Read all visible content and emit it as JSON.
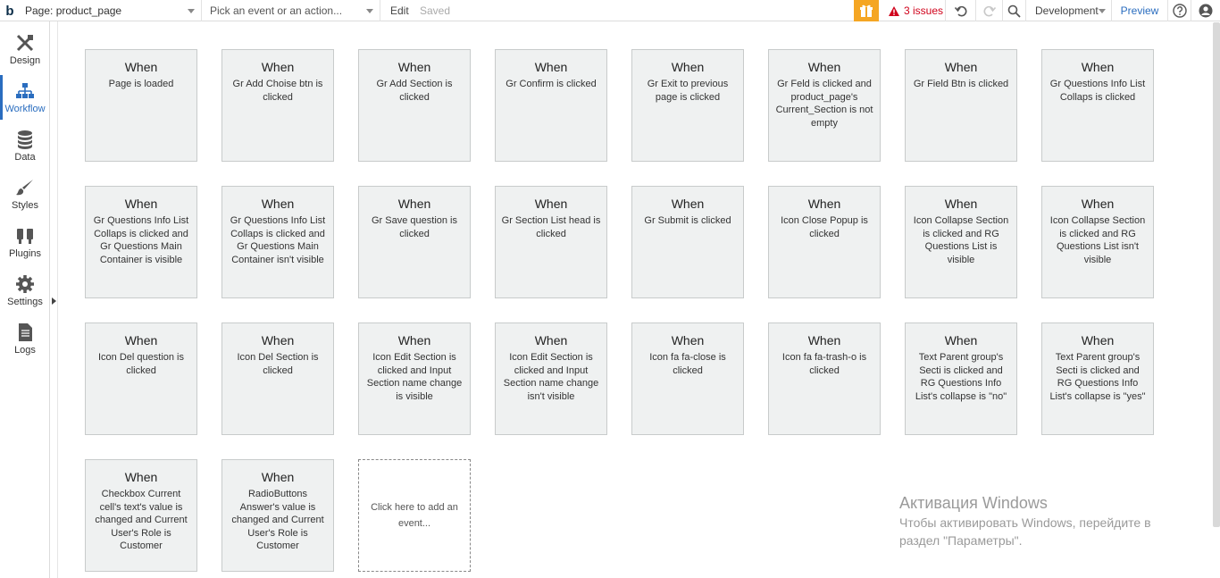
{
  "topbar": {
    "logo": "b",
    "page_select": "Page: product_page",
    "event_placeholder": "Pick an event or an action...",
    "edit_label": "Edit",
    "saved_label": "Saved",
    "issues_label": "3 issues",
    "environment": "Development",
    "preview_label": "Preview"
  },
  "sidebar": {
    "items": [
      {
        "label": "Design",
        "icon": "design-icon"
      },
      {
        "label": "Workflow",
        "icon": "workflow-icon",
        "active": true
      },
      {
        "label": "Data",
        "icon": "database-icon"
      },
      {
        "label": "Styles",
        "icon": "brush-icon"
      },
      {
        "label": "Plugins",
        "icon": "plug-icon"
      },
      {
        "label": "Settings",
        "icon": "gear-icon"
      },
      {
        "label": "Logs",
        "icon": "document-icon"
      }
    ]
  },
  "workflow": {
    "when_label": "When",
    "events": [
      "Page is loaded",
      "Gr Add Choise btn is clicked",
      "Gr Add Section is clicked",
      "Gr Confirm is clicked",
      "Gr Exit to previous page is clicked",
      "Gr Feld is clicked and product_page's Current_Section is not empty",
      "Gr Field Btn is clicked",
      "Gr Questions Info List Collaps is clicked",
      "Gr Questions Info List Collaps is clicked and Gr Questions Main Container is visible",
      "Gr Questions Info List Collaps is clicked and Gr Questions Main Container isn't visible",
      "Gr Save question is clicked",
      "Gr Section List head is clicked",
      "Gr Submit is clicked",
      "Icon Close Popup is clicked",
      "Icon Collapse Section is clicked and RG Questions List is visible",
      "Icon Collapse Section is clicked and RG Questions List isn't visible",
      "Icon Del question is clicked",
      "Icon Del Section is clicked",
      "Icon Edit Section is clicked and Input Section name change is visible",
      "Icon Edit Section is clicked and Input Section name change isn't visible",
      "Icon fa fa-close is clicked",
      "Icon fa fa-trash-o is clicked",
      "Text Parent group's Secti is clicked and RG Questions Info List's collapse is \"no\"",
      "Text Parent group's Secti is clicked and RG Questions Info List's collapse is \"yes\"",
      "Checkbox Current cell's text's value is changed and Current User's Role is Customer",
      "RadioButtons Answer's value is changed and Current User's Role is Customer"
    ],
    "add_event_label": "Click here to add an event..."
  },
  "watermark": {
    "title": "Активация Windows",
    "text": "Чтобы активировать Windows, перейдите в раздел \"Параметры\"."
  },
  "colors": {
    "accent": "#2a6dbf",
    "gift": "#f5a623",
    "issues": "#d0021b",
    "card_bg": "#eff1f1"
  }
}
